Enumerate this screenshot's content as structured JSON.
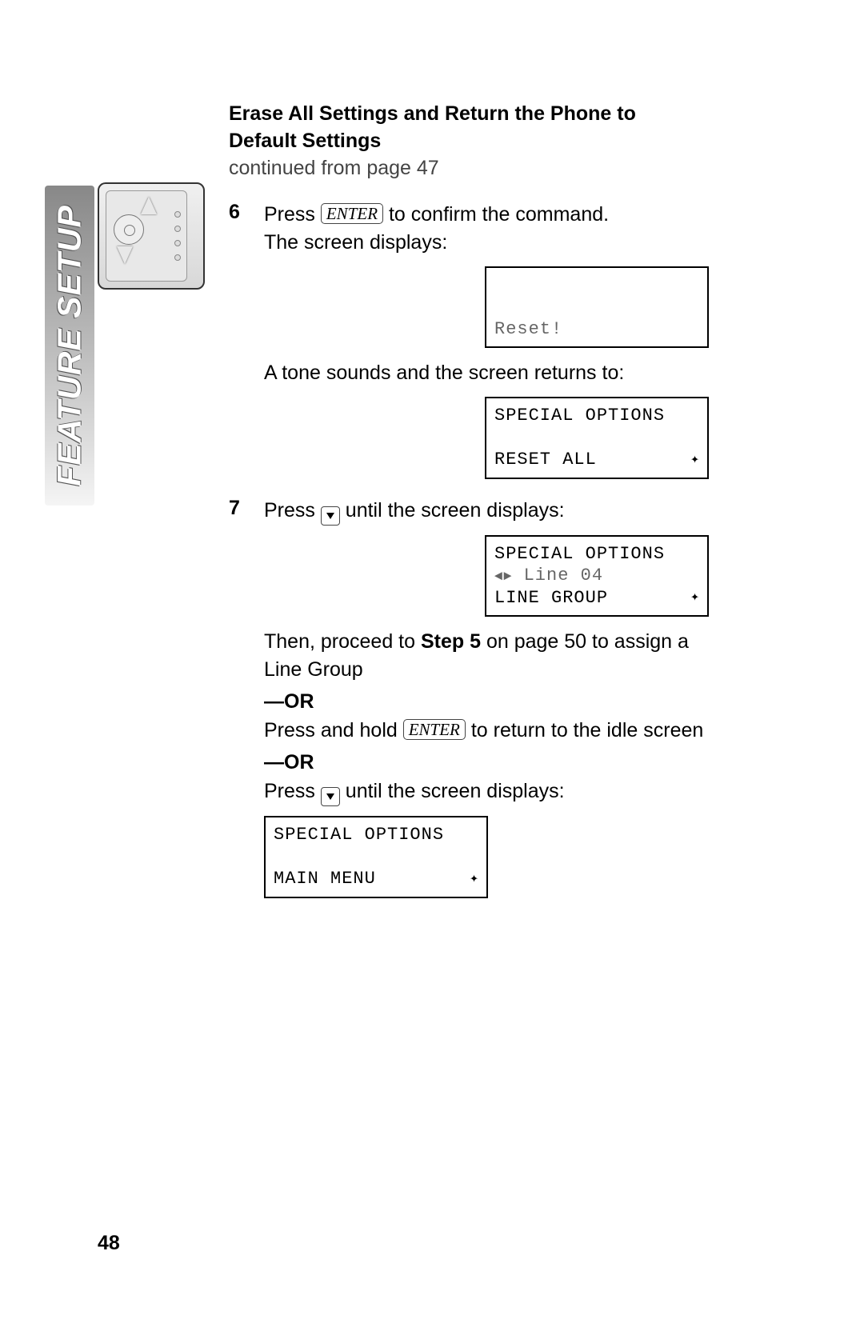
{
  "side_tab": "FEATURE SETUP",
  "heading_line1": "Erase All Settings and Return the Phone to",
  "heading_line2": "Default Settings",
  "continued": "continued from page 47",
  "step6": {
    "num": "6",
    "prefix": "Press ",
    "enter": "ENTER",
    "after_enter": " to confirm the command.",
    "line2": "The screen displays:"
  },
  "lcd1": {
    "row3": "Reset!"
  },
  "tone_text": "A tone sounds and the screen returns to:",
  "lcd2": {
    "row1": "SPECIAL OPTIONS",
    "row3": "RESET ALL",
    "nav": "✦"
  },
  "step7": {
    "num": "7",
    "prefix": "Press ",
    "after_down": " until the screen displays:"
  },
  "lcd3": {
    "row1": "SPECIAL OPTIONS",
    "row2_arrows": "◄►",
    "row2_text": " Line 04",
    "row3": "LINE GROUP",
    "nav": "✦"
  },
  "then_text_1": "Then, proceed to ",
  "then_bold": "Step 5",
  "then_text_2": " on page 50 to assign a Line Group",
  "or": "—OR",
  "press_hold_1": "Press and hold ",
  "press_hold_enter": "ENTER",
  "press_hold_2": " to return to the idle screen",
  "press_down_1": "Press ",
  "press_down_2": " until the screen displays:",
  "lcd4": {
    "row1": "SPECIAL OPTIONS",
    "row3": "MAIN MENU",
    "nav": "✦"
  },
  "page_number": "48"
}
